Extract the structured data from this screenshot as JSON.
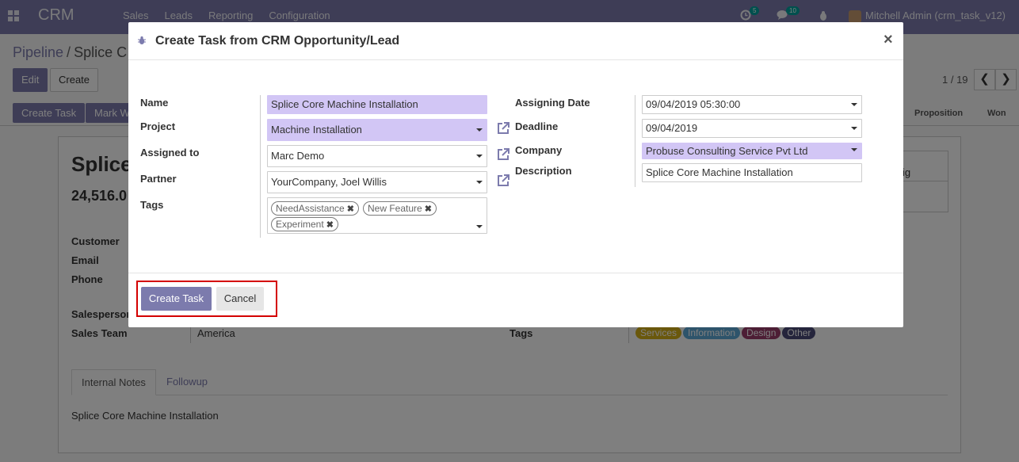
{
  "navbar": {
    "brand": "CRM",
    "menu": [
      "Sales",
      "Leads",
      "Reporting",
      "Configuration"
    ],
    "activity_count": "5",
    "message_count": "10",
    "user": "Mitchell Admin (crm_task_v12)"
  },
  "page": {
    "breadcrumb_parent": "Pipeline",
    "breadcrumb_current": "Splice C",
    "edit_label": "Edit",
    "create_label": "Create",
    "pager": "1 / 19",
    "create_task_label": "Create Task",
    "mark_won_label": "Mark W",
    "stages": [
      "Proposition",
      "Won"
    ],
    "title": "Splice",
    "revenue": "24,516.0",
    "labels": {
      "customer": "Customer",
      "email": "Email",
      "phone": "Phone",
      "salesperson": "Salesperson",
      "sales_team": "Sales Team",
      "tags": "Tags"
    },
    "sales_team_value": "America",
    "tags": [
      {
        "label": "Services",
        "color": "#d5b018"
      },
      {
        "label": "Information",
        "color": "#5da9d6"
      },
      {
        "label": "Design",
        "color": "#9b3c6b"
      },
      {
        "label": "Other",
        "color": "#4a4a78"
      }
    ],
    "box_fragment": "ig",
    "notes_tab": "Internal Notes",
    "followup_tab": "Followup",
    "notes_text": "Splice Core Machine Installation"
  },
  "modal": {
    "title": "Create Task from CRM Opportunity/Lead",
    "close_symbol": "×",
    "labels": {
      "name": "Name",
      "project": "Project",
      "assigned_to": "Assigned to",
      "partner": "Partner",
      "tags": "Tags",
      "assigning_date": "Assigning Date",
      "deadline": "Deadline",
      "company": "Company",
      "description": "Description"
    },
    "values": {
      "name": "Splice Core Machine Installation",
      "project": "Machine Installation",
      "assigned_to": "Marc Demo",
      "partner": "YourCompany, Joel Willis",
      "assigning_date": "09/04/2019 05:30:00",
      "deadline": "09/04/2019",
      "company": "Probuse Consulting Service Pvt Ltd",
      "description": "Splice Core Machine Installation"
    },
    "tags": [
      "NeedAssistance",
      "New Feature",
      "Experiment"
    ],
    "tag_remove_symbol": "✖",
    "create_task_button": "Create Task",
    "cancel_button": "Cancel"
  }
}
